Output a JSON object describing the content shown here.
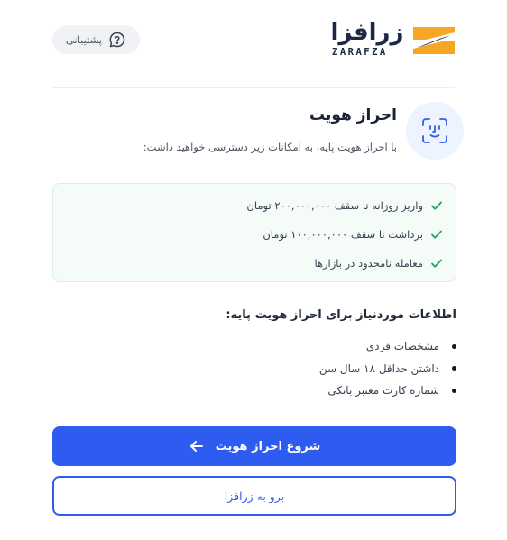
{
  "header": {
    "support_label": "پشتیبانی",
    "brand_name": "زرافزا",
    "brand_latin": "ZARAFZA"
  },
  "identity": {
    "title": "احراز هویت",
    "subtitle": "با احراز هویت پایه، به امکانات زیر دسترسی خواهید داشت:"
  },
  "perks": [
    "واریز روزانه تا سقف ۲۰۰,۰۰۰,۰۰۰ تومان",
    "برداشت تا سقف ۱۰۰,۰۰۰,۰۰۰ تومان",
    "معامله نامحدود در بازارها"
  ],
  "requirements": {
    "title": "اطلاعات موردنیاز برای احراز هویت پایه:",
    "items": [
      "مشخصات فردی",
      "داشتن حداقل ۱۸ سال سن",
      "شماره کارت معتبر بانکی"
    ]
  },
  "actions": {
    "primary_label": "شروع احراز هویت",
    "secondary_label": "برو به زرافزا"
  },
  "colors": {
    "accent": "#2f5cf0",
    "brand_orange": "#f5a623",
    "check_green": "#22a06b",
    "perks_bg": "#f5fbf7"
  }
}
